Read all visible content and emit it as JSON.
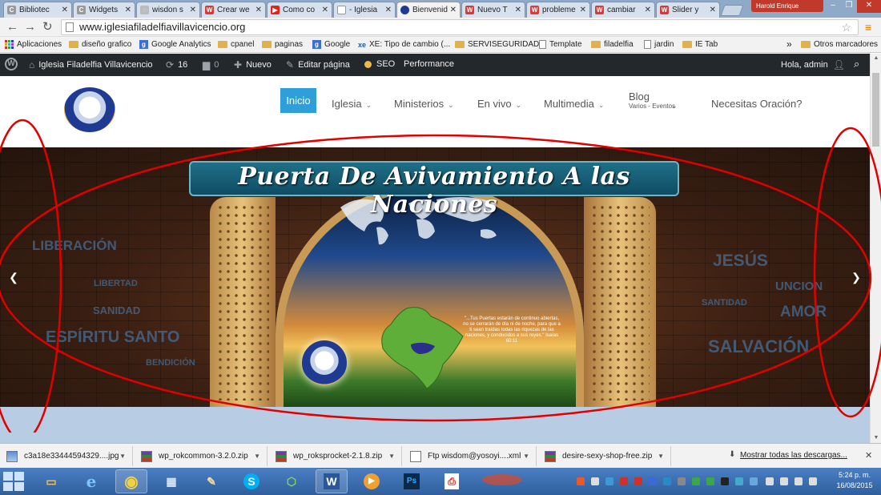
{
  "browser": {
    "tabs": [
      {
        "label": "Bibliotec",
        "favicon": "c-icon",
        "fav_color": "#999999"
      },
      {
        "label": "Widgets",
        "favicon": "c-icon",
        "fav_color": "#999999"
      },
      {
        "label": "wisdon s",
        "favicon": "loading-icon",
        "fav_color": "#bbbbbb"
      },
      {
        "label": "Crear we",
        "favicon": "w-icon",
        "fav_color": "#d83a3a"
      },
      {
        "label": "Como co",
        "favicon": "youtube-icon",
        "fav_color": "#e62117"
      },
      {
        "label": "- Iglesia",
        "favicon": "page-icon",
        "fav_color": "#dddddd"
      },
      {
        "label": "Bienvenido",
        "favicon": "site-icon",
        "fav_color": "#1f3a93"
      },
      {
        "label": "Nuevo T",
        "favicon": "w-icon",
        "fav_color": "#d83a3a"
      },
      {
        "label": "probleme",
        "favicon": "w-icon",
        "fav_color": "#d83a3a"
      },
      {
        "label": "cambiar",
        "favicon": "w-icon",
        "fav_color": "#d83a3a"
      },
      {
        "label": "Slider y",
        "favicon": "w-icon",
        "fav_color": "#d83a3a"
      }
    ],
    "active_tab_index": 6,
    "user_badge": "Harold Enrique",
    "window_controls": {
      "minimize": "–",
      "maximize": "❐",
      "close": "✕"
    },
    "url": "www.iglesiafiladelfiavillavicencio.org",
    "bookmarks": [
      {
        "label": "Aplicaciones",
        "icon": "apps-icon"
      },
      {
        "label": "diseño grafico",
        "icon": "folder-icon"
      },
      {
        "label": "Google Analytics",
        "icon": "google-icon"
      },
      {
        "label": "cpanel",
        "icon": "folder-icon"
      },
      {
        "label": "paginas",
        "icon": "folder-icon"
      },
      {
        "label": "Google",
        "icon": "google-icon"
      },
      {
        "label": "XE: Tipo de cambio (...",
        "icon": "xe-icon"
      },
      {
        "label": "SERVISEGURIDAD",
        "icon": "folder-icon"
      },
      {
        "label": "Template",
        "icon": "page-icon"
      },
      {
        "label": "filadelfia",
        "icon": "folder-icon"
      },
      {
        "label": "jardin",
        "icon": "page-icon"
      },
      {
        "label": "IE Tab",
        "icon": "folder-icon"
      }
    ],
    "bookmarks_overflow": "»",
    "other_bookmarks": "Otros marcadores"
  },
  "wp_admin_bar": {
    "site_name": "Iglesia Filadelfia Villavicencio",
    "updates_count": "16",
    "comments_count": "0",
    "new_label": "Nuevo",
    "edit_label": "Editar página",
    "seo_label": "SEO",
    "performance_label": "Performance",
    "greeting": "Hola, admin"
  },
  "site_nav": {
    "items": [
      {
        "label": "Inicio",
        "dropdown": false,
        "active": true
      },
      {
        "label": "Iglesia",
        "dropdown": true
      },
      {
        "label": "Ministerios",
        "dropdown": true
      },
      {
        "label": "En vivo",
        "dropdown": true
      },
      {
        "label": "Multimedia",
        "dropdown": true
      },
      {
        "label": "Blog",
        "dropdown": true
      },
      {
        "label": "Necesitas Oración?",
        "dropdown": false
      }
    ],
    "blog_subtitle": "Varios - Eventos",
    "accent_color": "#2e9fd8"
  },
  "slider": {
    "title": "Puerta De Avivamiento A las Naciones",
    "left_words": [
      "LIBERACIÓN",
      "LIBERTAD",
      "SANIDAD",
      "ESPÍRITU SANTO",
      "BENDICIÓN"
    ],
    "right_words": [
      "JESÚS",
      "UNCION",
      "SANTIDAD",
      "AMOR",
      "SALVACIÓN"
    ],
    "verse": "\"...Tus Puertas estarán de continuo abiertas, no se cerrarán de día ni de noche, para que a ti sean traídas todas las riquezas de las naciones, y conducidos a sus reyes.\" Isaías 60:11",
    "prev_arrow": "❮",
    "next_arrow": "❯"
  },
  "downloads": {
    "items": [
      {
        "name": "c3a18e33444594329....jpg",
        "type": "image"
      },
      {
        "name": "wp_rokcommon-3.2.0.zip",
        "type": "zip"
      },
      {
        "name": "wp_roksprocket-2.1.8.zip",
        "type": "zip"
      },
      {
        "name": "Ftp wisdom@yosoyi....xml",
        "type": "xml"
      },
      {
        "name": "desire-sexy-shop-free.zip",
        "type": "zip"
      }
    ],
    "show_all": "Mostrar todas las descargas...",
    "close": "✕"
  },
  "taskbar": {
    "apps": [
      {
        "name": "file-explorer-icon",
        "glyph": "🗀",
        "color": "#e8c56a"
      },
      {
        "name": "internet-explorer-icon",
        "glyph": "e",
        "color": "#2b7cd3"
      },
      {
        "name": "chrome-icon",
        "glyph": "◉",
        "color": "#e04a3a",
        "open": true
      },
      {
        "name": "calculator-icon",
        "glyph": "▦",
        "color": "#9fb4cc"
      },
      {
        "name": "paint-icon",
        "glyph": "✎",
        "color": "#e9d3a3"
      },
      {
        "name": "skype-icon",
        "glyph": "S",
        "color": "#00aff0"
      },
      {
        "name": "camtasia-icon",
        "glyph": "⬡",
        "color": "#3fa64a"
      },
      {
        "name": "word-icon",
        "glyph": "W",
        "color": "#2b5797"
      },
      {
        "name": "media-player-icon",
        "glyph": "▶",
        "color": "#f0a030"
      },
      {
        "name": "photoshop-icon",
        "glyph": "Ps",
        "color": "#0b2a4a"
      },
      {
        "name": "pdf-icon",
        "glyph": "⎙",
        "color": "#d0302a"
      }
    ],
    "clock_time": "5:24 p. m.",
    "clock_date": "16/08/2015"
  },
  "annotation_color": "#e00000"
}
